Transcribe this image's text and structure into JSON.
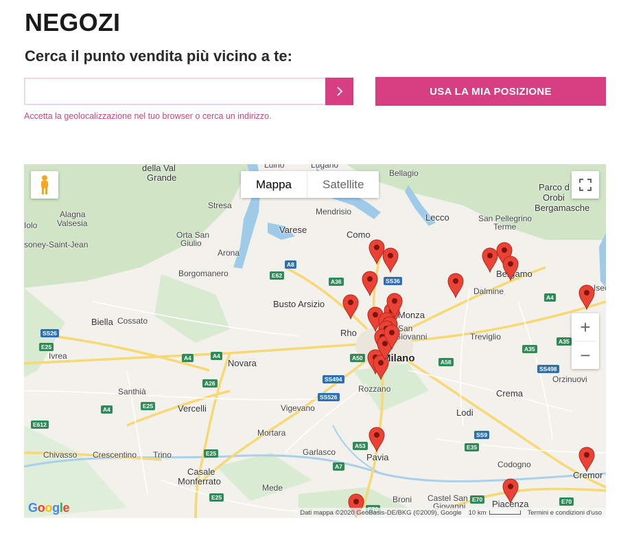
{
  "page": {
    "title": "NEGOZI",
    "subtitle": "Cerca il punto vendita più vicino a te:"
  },
  "search": {
    "value": "",
    "placeholder": "",
    "button_icon": "chevron-right-icon"
  },
  "geo_button": {
    "label": "USA LA MIA POSIZIONE"
  },
  "hint": "Accetta la geolocalizzazione nel tuo browser o cerca un indirizzo.",
  "colors": {
    "accent": "#d63f82",
    "hint": "#c9447d",
    "pin": "#ea4335"
  },
  "map": {
    "type_control": {
      "map_label": "Mappa",
      "satellite_label": "Satellite",
      "selected": "Mappa"
    },
    "zoom_in_label": "+",
    "zoom_out_label": "−",
    "logo": "Google",
    "attribution": "Dati mappa ©2020 GeoBasis-DE/BKG (©2009), Google",
    "scale_label": "10 km",
    "terms_label": "Termini e condizioni d'uso",
    "places": {
      "della_val_grande": "della Val",
      "grande": "Grande",
      "luino": "Luino",
      "lugano": "Lugano",
      "bellagio": "Bellagio",
      "parco_orobie_1": "Parco d",
      "parco_orobie_2": "Orobi",
      "parco_orobie_3": "Bergamasche",
      "domodossola": "Iolo",
      "alagna": "Alagna",
      "valsesia": "Valsesia",
      "stresa": "Stresa",
      "mendrisio": "Mendrisio",
      "lecco": "Lecco",
      "san_pellegrino_1": "San Pellegrino",
      "san_pellegrino_2": "Terme",
      "gressoney": "soney-Saint-Jean",
      "orta_1": "Orta San",
      "orta_2": "Giulio",
      "varese": "Varese",
      "como": "Como",
      "arona": "Arona",
      "borgomanero": "Borgomanero",
      "bergamo": "Bergamo",
      "dalmine": "Dalmine",
      "busto_arsizio": "Busto Arsizio",
      "monza": "Monza",
      "sesto_1": "San",
      "sesto_2": "Giovanni",
      "biella": "Biella",
      "cossato": "Cossato",
      "rho": "Rho",
      "treviglio": "Treviglio",
      "ivrea": "Ivrea",
      "novara": "Novara",
      "milano": "Milano",
      "orzinuovi": "Orzinuovi",
      "santhia": "Santhià",
      "rozzano": "Rozzano",
      "crema": "Crema",
      "vercelli": "Vercelli",
      "vigevano": "Vigevano",
      "lodi": "Lodi",
      "mortara": "Mortara",
      "chivasso": "Chivasso",
      "crescentino": "Crescentino",
      "trino": "Trino",
      "garlasco": "Garlasco",
      "pavia": "Pavia",
      "codogno": "Codogno",
      "casale_1": "Casale",
      "casale_2": "Monferrato",
      "cremona": "Cremor",
      "mede": "Mede",
      "broni": "Broni",
      "castel_san_1": "Castel San",
      "castel_san_2": "Giovanni",
      "piacenza": "Piacenza",
      "isea": "Isec"
    },
    "shields": {
      "a8": "A8",
      "e62": "E62",
      "a36": "A36",
      "ss36": "SS36",
      "a4a": "A4",
      "ss26": "SS26",
      "e25a": "E25",
      "a4b": "A4",
      "a4c": "A4",
      "a26": "A26",
      "a50": "A50",
      "ss494": "SS494",
      "a58": "A58",
      "ss526": "SS526",
      "a4d": "A4",
      "e25b": "E25",
      "e612": "E612",
      "a35a": "A35",
      "a35b": "A35",
      "ss498": "SS498",
      "ss9": "SS9",
      "e35": "E35",
      "a53": "A53",
      "e25c": "E25",
      "a7": "A7",
      "e70a": "E70",
      "e25d": "E25",
      "e70b": "E70",
      "a4e": "A4",
      "a21": "E70"
    },
    "markers_count": 24
  }
}
